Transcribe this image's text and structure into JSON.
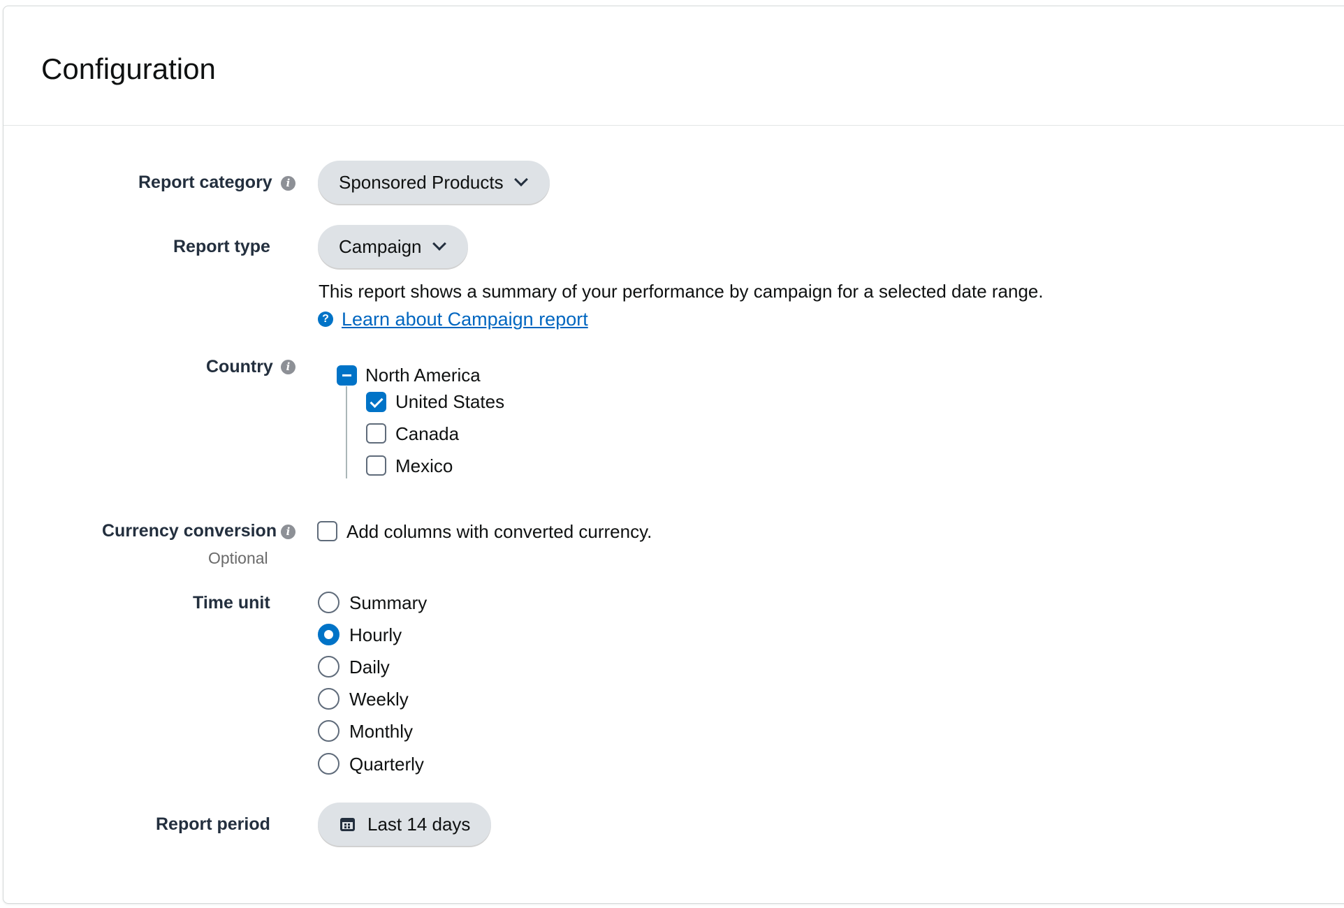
{
  "configuration": {
    "title": "Configuration"
  },
  "report_category": {
    "label": "Report category",
    "info_icon": "info-icon",
    "selected": "Sponsored Products"
  },
  "report_type": {
    "label": "Report type",
    "selected": "Campaign",
    "description": "This report shows a summary of your performance by campaign for a selected date range.",
    "help_icon": "help-icon",
    "learn_link": "Learn about Campaign report"
  },
  "country": {
    "label": "Country",
    "info_icon": "info-icon",
    "region": {
      "name": "North America",
      "state": "indeterminate"
    },
    "items": [
      {
        "name": "United States",
        "checked": true
      },
      {
        "name": "Canada",
        "checked": false
      },
      {
        "name": "Mexico",
        "checked": false
      }
    ]
  },
  "currency_conversion": {
    "label": "Currency conversion",
    "info_icon": "info-icon",
    "optional_text": "Optional",
    "checkbox_label": "Add columns with converted currency.",
    "checked": false
  },
  "time_unit": {
    "label": "Time unit",
    "options": [
      {
        "label": "Summary",
        "selected": false
      },
      {
        "label": "Hourly",
        "selected": true
      },
      {
        "label": "Daily",
        "selected": false
      },
      {
        "label": "Weekly",
        "selected": false
      },
      {
        "label": "Monthly",
        "selected": false
      },
      {
        "label": "Quarterly",
        "selected": false
      }
    ]
  },
  "report_period": {
    "label": "Report period",
    "icon": "calendar-icon",
    "selected": "Last 14 days"
  },
  "colors": {
    "accent": "#0073c7",
    "link": "#0066c0",
    "pill_bg": "#dee2e6",
    "label_text": "#232f3e"
  }
}
